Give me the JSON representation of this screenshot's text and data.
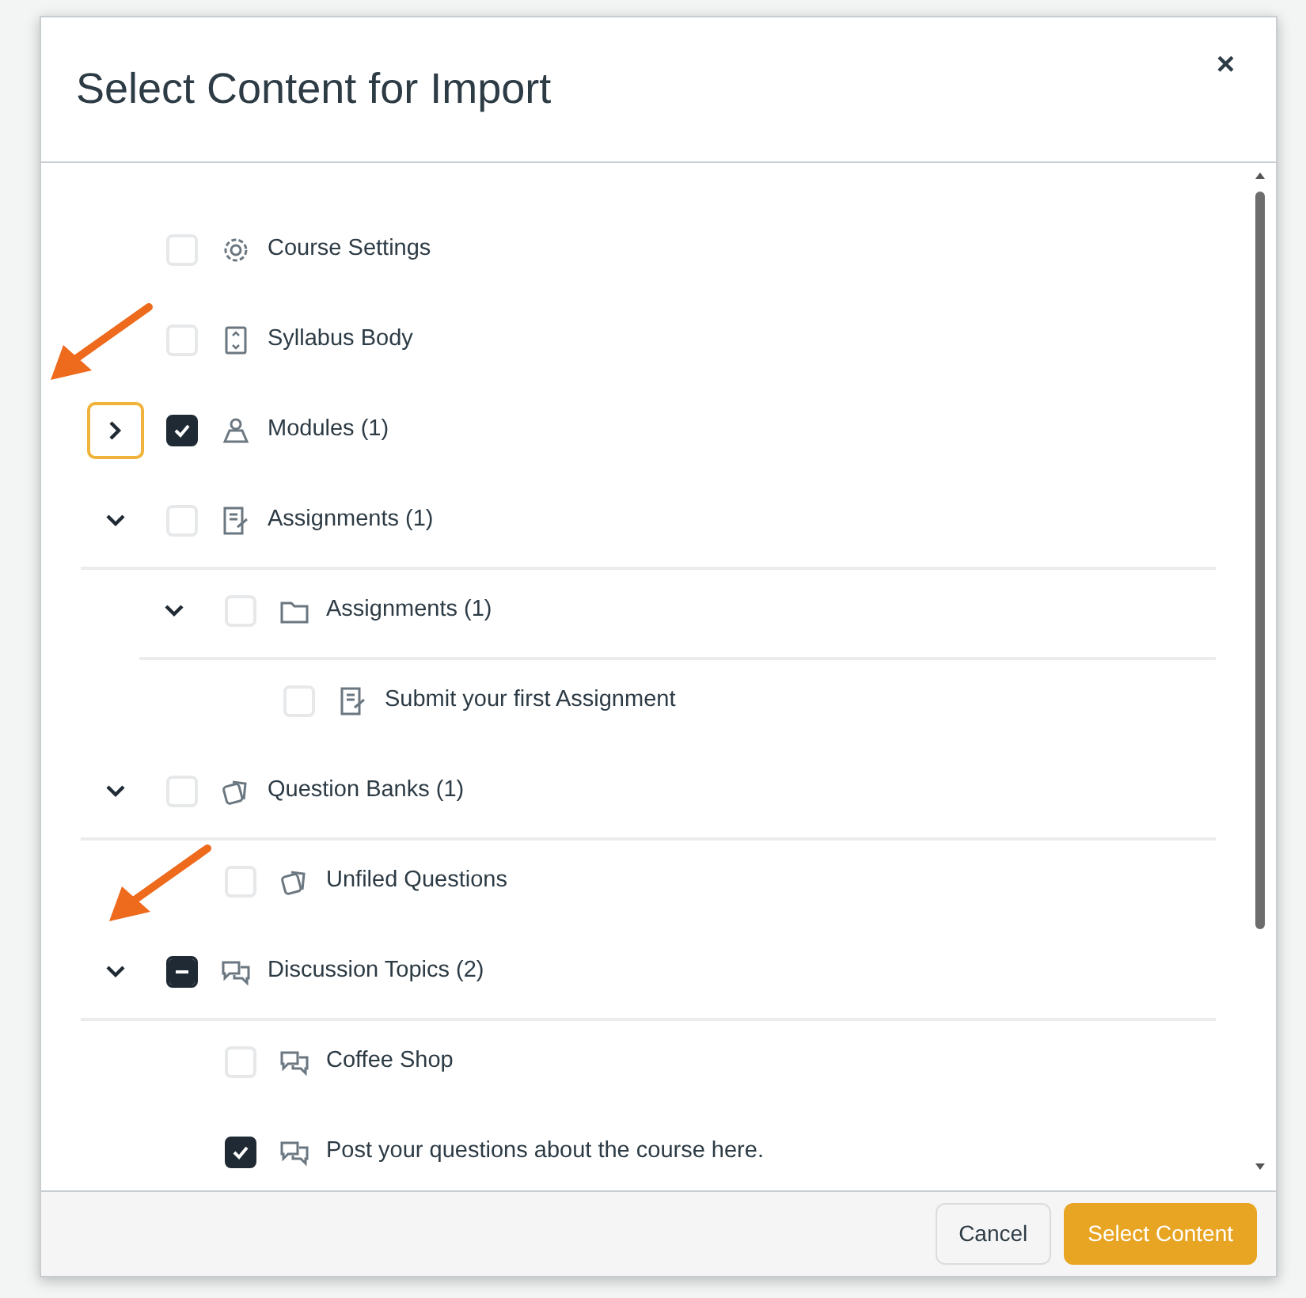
{
  "dialog": {
    "title": "Select Content for Import",
    "close": "×"
  },
  "items": [
    {
      "label": "Course Settings",
      "kind": "gear",
      "checked": false,
      "mixed": false,
      "marked": false
    },
    {
      "label": "Syllabus Body",
      "kind": "syllabus",
      "checked": false,
      "mixed": false,
      "marked": true
    },
    {
      "label": "Modules (1)",
      "kind": "modules",
      "checked": true,
      "mixed": false,
      "expanded": false,
      "focused": true,
      "marked": false
    },
    {
      "label": "Assignments (1)",
      "kind": "assignment",
      "checked": false,
      "mixed": false,
      "expanded": true,
      "focused": false,
      "marked": false,
      "children": [
        {
          "label": "Assignments (1)",
          "kind": "folder",
          "checked": false,
          "mixed": false,
          "expanded": true,
          "focused": false,
          "marked": false,
          "children": [
            {
              "label": "Submit your first Assignment",
              "kind": "assignment",
              "checked": false,
              "mixed": false,
              "marked": false
            }
          ]
        }
      ]
    },
    {
      "label": "Question Banks (1)",
      "kind": "quiz",
      "checked": false,
      "mixed": false,
      "expanded": true,
      "focused": false,
      "marked": false,
      "children": [
        {
          "label": "Unfiled Questions",
          "kind": "quiz",
          "checked": false,
          "mixed": false,
          "marked": true
        }
      ]
    },
    {
      "label": "Discussion Topics (2)",
      "kind": "discussion",
      "mixed": true,
      "expanded": true,
      "focused": false,
      "marked": false,
      "children": [
        {
          "label": "Coffee Shop",
          "kind": "discussion",
          "checked": false,
          "mixed": false,
          "marked": false
        },
        {
          "label": "Post your questions about the course here.",
          "kind": "discussion",
          "checked": true,
          "mixed": false,
          "marked": false
        }
      ]
    }
  ],
  "buttons": [
    {
      "label": "Cancel",
      "kind": "secondary"
    },
    {
      "label": "Select Content",
      "kind": "primary"
    }
  ]
}
